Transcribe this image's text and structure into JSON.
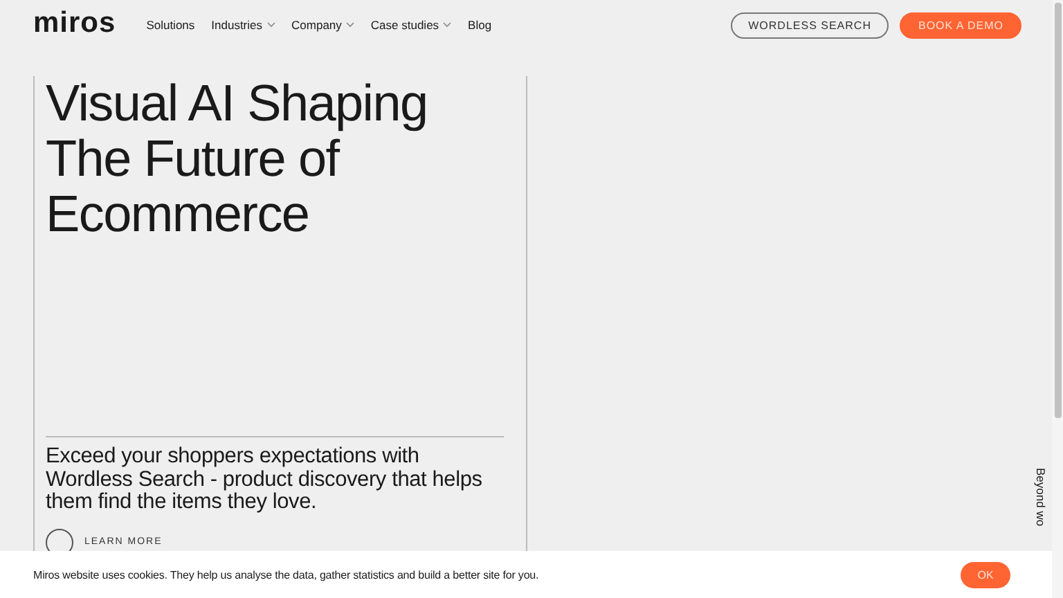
{
  "logo": "miros",
  "nav": [
    {
      "label": "Solutions",
      "dropdown": false
    },
    {
      "label": "Industries",
      "dropdown": true
    },
    {
      "label": "Company",
      "dropdown": true
    },
    {
      "label": "Case studies",
      "dropdown": true
    },
    {
      "label": "Blog",
      "dropdown": false
    }
  ],
  "header_buttons": [
    {
      "label": "WORDLESS SEARCH",
      "kind": "outline"
    },
    {
      "label": "BOOK A DEMO",
      "kind": "primary"
    }
  ],
  "hero": {
    "title_lines": [
      "Visual AI Shaping",
      "The Future of",
      "Ecommerce"
    ],
    "subtitle": "Exceed your shoppers expectations with Wordless Search - product discovery that helps them find the items they love.",
    "link": "LEARN MORE"
  },
  "side_text": "Beyond wo",
  "cookie_banner": {
    "text": "Miros website uses cookies. They help us analyse the data, gather statistics and build a better site for you.",
    "button": "OK"
  }
}
